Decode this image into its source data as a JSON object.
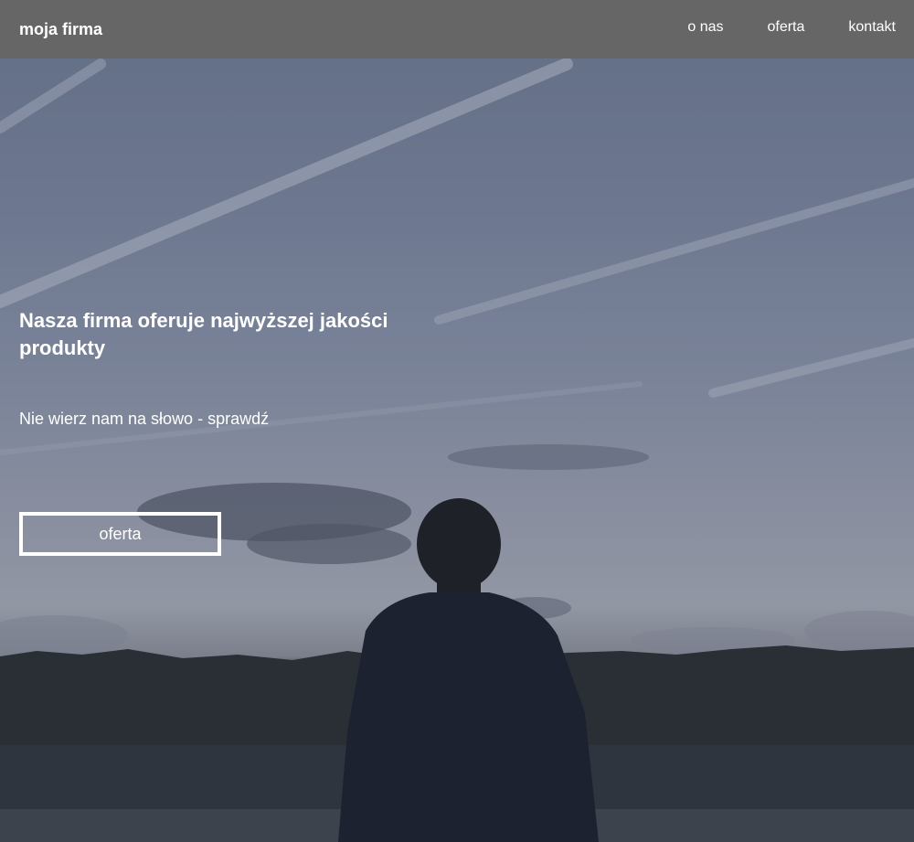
{
  "nav": {
    "brand": "moja firma",
    "links": [
      "o nas",
      "oferta",
      "kontakt"
    ]
  },
  "hero": {
    "title": "Nasza firma oferuje najwyższej jakości produkty",
    "subtitle": "Nie wierz nam na słowo - sprawdź",
    "button_label": "oferta",
    "background_image": "man-standing-by-lake-at-dusk"
  },
  "colors": {
    "navbar_bg": "#666666",
    "text": "#ffffff",
    "button_border": "#ffffff"
  }
}
